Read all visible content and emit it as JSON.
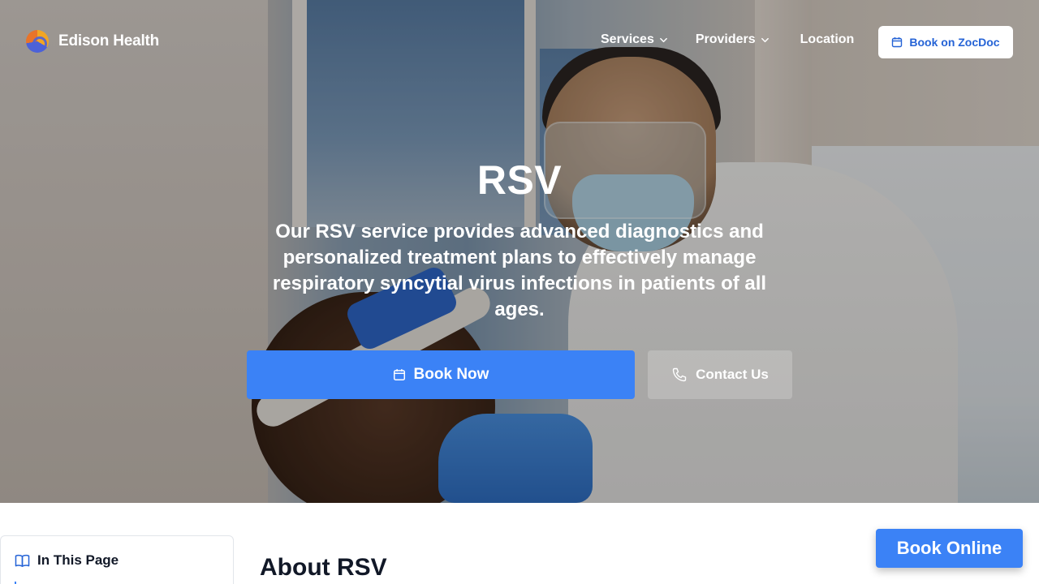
{
  "brand": {
    "name": "Edison Health"
  },
  "nav": {
    "items": [
      {
        "label": "Services",
        "has_dropdown": true
      },
      {
        "label": "Providers",
        "has_dropdown": true
      },
      {
        "label": "Location",
        "has_dropdown": false
      }
    ],
    "cta": {
      "label": "Book on ZocDoc",
      "icon": "calendar-icon"
    }
  },
  "hero": {
    "title": "RSV",
    "subtitle": "Our RSV service provides advanced diagnostics and personalized treatment plans to effectively manage respiratory syncytial virus infections in patients of all ages.",
    "primary_button": {
      "label": "Book Now",
      "icon": "calendar-icon"
    },
    "secondary_button": {
      "label": "Contact Us",
      "icon": "phone-icon"
    }
  },
  "toc": {
    "title": "In This Page",
    "icon": "book-open-icon"
  },
  "main": {
    "section_title": "About RSV"
  },
  "floating_cta": {
    "label": "Book Online"
  },
  "colors": {
    "primary": "#3b82f6",
    "link_blue": "#2563d6",
    "text_dark": "#111827"
  }
}
